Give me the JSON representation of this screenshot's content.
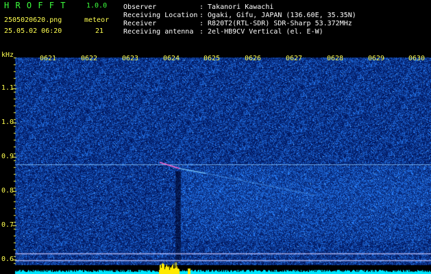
{
  "app": {
    "name": "H R O F F T",
    "version": "1.0.0",
    "filename": "2505020620.png",
    "datetime": "25.05.02 06:20",
    "meteor_label": "meteor",
    "meteor_count": "21"
  },
  "info": {
    "labels": [
      "Observer",
      "Receiving Location",
      "Receiver",
      "Receiving antenna"
    ],
    "values": [
      ": Takanori Kawachi",
      ": Ogaki, Gifu, JAPAN (136.60E, 35.35N)",
      ": R820T2(RTL-SDR) SDR-Sharp 53.372MHz",
      ": 2el-HB9CV Vertical (el. E-W)"
    ]
  },
  "axes": {
    "y_unit": "kHz",
    "y_ticks": [
      "1.1",
      "1.0",
      "0.9",
      "0.8",
      "0.7",
      "0.6"
    ],
    "x_ticks": [
      "0621",
      "0622",
      "0623",
      "0624",
      "0625",
      "0626",
      "0627",
      "0628",
      "0629",
      "0630"
    ]
  },
  "colors": {
    "background": "#000000",
    "noise": "#0a1ea8",
    "labels": "#ffff50",
    "title": "#3cff3c",
    "signal": "#00e5ff",
    "burst": "#ffea00"
  }
}
